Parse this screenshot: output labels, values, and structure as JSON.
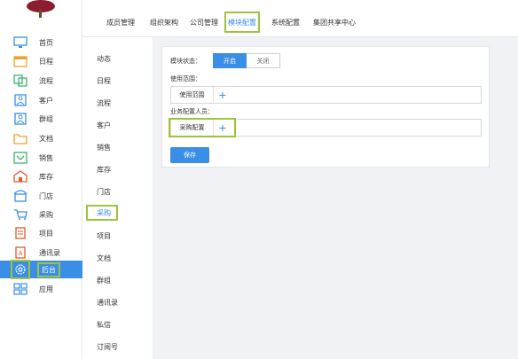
{
  "nav": {
    "items": [
      {
        "label": "首页",
        "icon": "desktop-icon"
      },
      {
        "label": "日程",
        "icon": "calendar-icon"
      },
      {
        "label": "流程",
        "icon": "flow-icon"
      },
      {
        "label": "客户",
        "icon": "customer-icon"
      },
      {
        "label": "群组",
        "icon": "group-icon"
      },
      {
        "label": "文档",
        "icon": "folder-icon"
      },
      {
        "label": "销售",
        "icon": "sales-icon"
      },
      {
        "label": "库存",
        "icon": "warehouse-icon"
      },
      {
        "label": "门店",
        "icon": "store-icon"
      },
      {
        "label": "采购",
        "icon": "cart-icon"
      },
      {
        "label": "项目",
        "icon": "project-icon"
      },
      {
        "label": "通讯录",
        "icon": "contacts-icon"
      },
      {
        "label": "后台",
        "icon": "settings-icon"
      },
      {
        "label": "应用",
        "icon": "apps-icon"
      }
    ]
  },
  "tabs": [
    "成员管理",
    "组织架构",
    "公司管理",
    "模块配置",
    "系统配置",
    "集团共享中心"
  ],
  "modules": [
    "动态",
    "日程",
    "流程",
    "客户",
    "销售",
    "库存",
    "门店",
    "采购",
    "项目",
    "文档",
    "群组",
    "通讯录",
    "私信",
    "订阅号"
  ],
  "panel": {
    "status_label": "模块状态：",
    "on_label": "开启",
    "off_label": "关闭",
    "scope_label": "使用范围：",
    "scope_chip": "使用范围",
    "staff_label": "业务配置人员：",
    "staff_chip": "采购配置",
    "save_label": "保存"
  },
  "colors": {
    "accent": "#3a8ee6",
    "highlight": "#9bc53d"
  }
}
